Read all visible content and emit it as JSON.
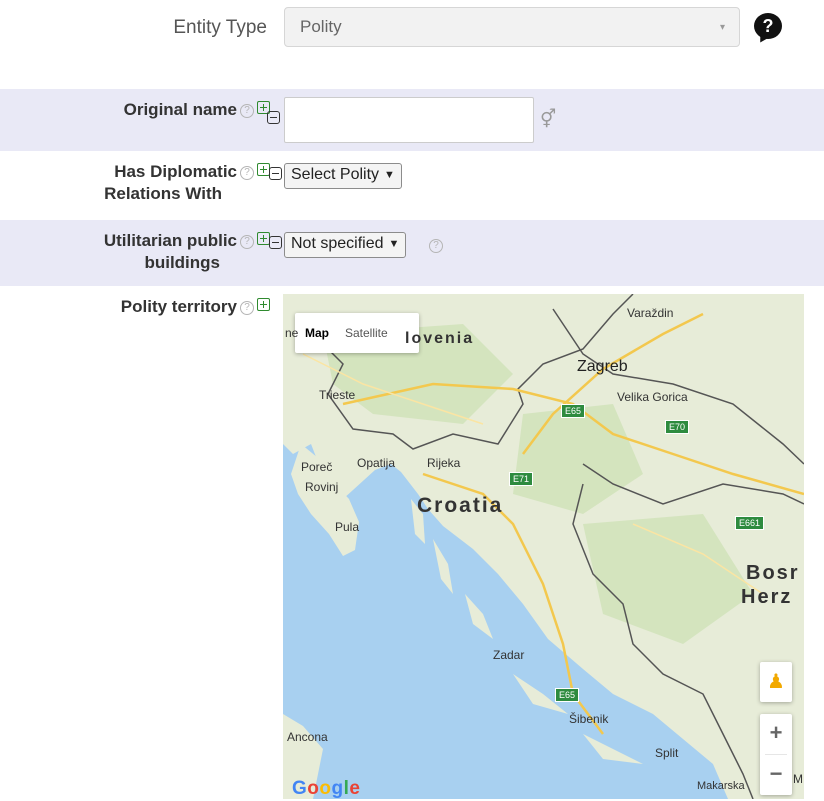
{
  "entity_type": {
    "label": "Entity Type",
    "value": "Polity",
    "caret": "▾",
    "help": "?"
  },
  "fields": {
    "original_name": {
      "label": "Original name",
      "value": ""
    },
    "diplomatic": {
      "label_line1": "Has Diplomatic",
      "label_line2": "Relations With",
      "select": "Select Polity"
    },
    "utilitarian": {
      "label_line1": "Utilitarian public",
      "label_line2": "buildings",
      "select": "Not specified"
    },
    "territory": {
      "label": "Polity territory"
    }
  },
  "icons": {
    "help": "?",
    "select_arrow": "▼",
    "gender": "⚥"
  },
  "map": {
    "tab_map": "Map",
    "tab_satellite": "Satellite",
    "zoom_in": "+",
    "zoom_out": "−",
    "pegman": "♟",
    "google_letters": [
      "G",
      "o",
      "o",
      "g",
      "l",
      "e"
    ],
    "countries": {
      "croatia": "Croatia",
      "slovenia": "lovenia",
      "bosnia1": "Bosr",
      "bosnia2": "Herz"
    },
    "cities": {
      "zagreb": "Zagreb",
      "varazdin": "Varaždin",
      "velika": "Velika Gorica",
      "trieste": "Trieste",
      "porec": "Poreč",
      "opatija": "Opatija",
      "rijeka": "Rijeka",
      "rovinj": "Rovinj",
      "pula": "Pula",
      "zadar": "Zadar",
      "sibenik": "Šibenik",
      "split": "Split",
      "ancona": "Ancona",
      "makarska": "Makarska",
      "ne": "ne",
      "m": "M"
    },
    "roads": {
      "e65a": "E65",
      "e70": "E70",
      "e71": "E71",
      "e661": "E661",
      "e65b": "E65"
    }
  },
  "colors": {
    "row_shade": "#e9e9f6",
    "plus_green": "#2f8a2f",
    "sea": "#a8d0f0",
    "land": "#e6ecd9"
  }
}
